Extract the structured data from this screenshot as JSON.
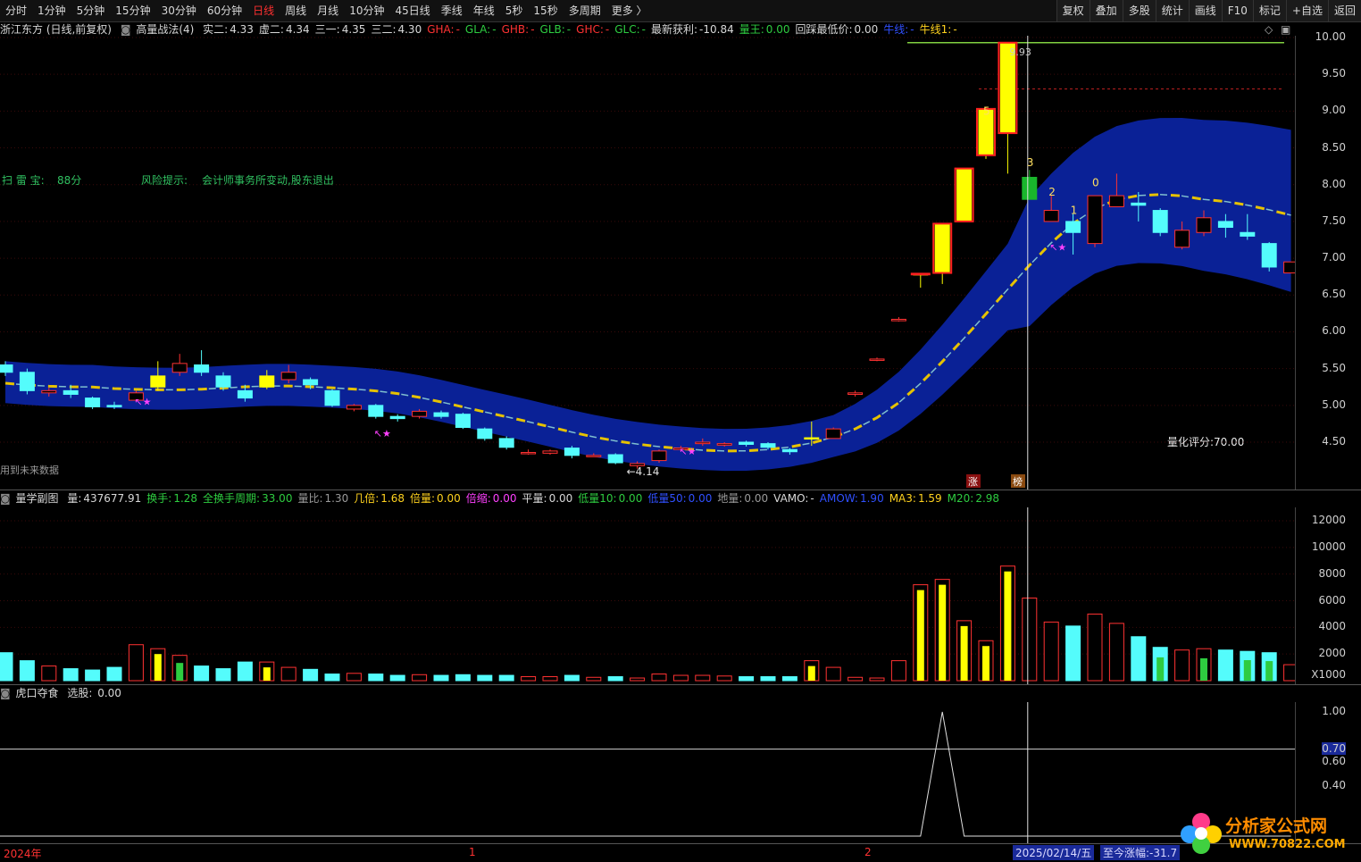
{
  "toolbar": {
    "periods": [
      "分时",
      "1分钟",
      "5分钟",
      "15分钟",
      "30分钟",
      "60分钟",
      "日线",
      "周线",
      "月线",
      "10分钟",
      "45日线",
      "季线",
      "年线",
      "5秒",
      "15秒",
      "多周期",
      "更多 〉"
    ],
    "active_period": "日线",
    "right_buttons": [
      "复权",
      "叠加",
      "多股",
      "统计",
      "画线",
      "F10",
      "标记",
      "+自选",
      "返回"
    ]
  },
  "main_info": {
    "stock": "浙江东方 (日线,前复权)",
    "indicator": "高量战法(4)",
    "items": [
      {
        "label": "实二:",
        "value": "4.33",
        "color": "w"
      },
      {
        "label": "虚二:",
        "value": "4.34",
        "color": "w"
      },
      {
        "label": "三一:",
        "value": "4.35",
        "color": "w"
      },
      {
        "label": "三二:",
        "value": "4.30",
        "color": "w"
      },
      {
        "label": "GHA:",
        "value": "-",
        "color": "r"
      },
      {
        "label": "GLA:",
        "value": "-",
        "color": "g"
      },
      {
        "label": "GHB:",
        "value": "-",
        "color": "r"
      },
      {
        "label": "GLB:",
        "value": "-",
        "color": "g"
      },
      {
        "label": "GHC:",
        "value": "-",
        "color": "r"
      },
      {
        "label": "GLC:",
        "value": "-",
        "color": "g"
      },
      {
        "label": "最新获利:",
        "value": "-10.84",
        "color": "w"
      },
      {
        "label": "量王:",
        "value": "0.00",
        "color": "g"
      },
      {
        "label": "回踩最低价:",
        "value": "0.00",
        "color": "w"
      },
      {
        "label": "牛线:",
        "value": "-",
        "color": "b"
      },
      {
        "label": "牛线1:",
        "value": "-",
        "color": "y"
      }
    ],
    "scan_label": "扫 雷 宝:",
    "scan_value": "88分",
    "risk_label": "风险提示:",
    "risk_value": "会计师事务所变动,股东退出",
    "future_note": "用到未来数据",
    "score_label": "量化评分:70.00",
    "low_label": "←4.14",
    "high_label": "9.93",
    "markers": {
      "zhang": "涨",
      "bang": "榜"
    },
    "candle_numbers": [
      "5",
      "3",
      "2",
      "1",
      "0"
    ]
  },
  "price_axis": [
    "10.00",
    "9.50",
    "9.00",
    "8.50",
    "8.00",
    "7.50",
    "7.00",
    "6.50",
    "6.00",
    "5.50",
    "5.00",
    "4.50"
  ],
  "volume_info": {
    "title": "量学副图",
    "items": [
      {
        "label": "量:",
        "value": "437677.91",
        "color": "w"
      },
      {
        "label": "换手:",
        "value": "1.28",
        "color": "g"
      },
      {
        "label": "全换手周期:",
        "value": "33.00",
        "color": "g"
      },
      {
        "label": "量比:",
        "value": "1.30",
        "color": "gr"
      },
      {
        "label": "几倍:",
        "value": "1.68",
        "color": "y"
      },
      {
        "label": "倍量:",
        "value": "0.00",
        "color": "y"
      },
      {
        "label": "倍缩:",
        "value": "0.00",
        "color": "m"
      },
      {
        "label": "平量:",
        "value": "0.00",
        "color": "w"
      },
      {
        "label": "低量10:",
        "value": "0.00",
        "color": "g"
      },
      {
        "label": "低量50:",
        "value": "0.00",
        "color": "b"
      },
      {
        "label": "地量:",
        "value": "0.00",
        "color": "gr"
      },
      {
        "label": "VAMO:",
        "value": "-",
        "color": "w"
      },
      {
        "label": "AMOW:",
        "value": "1.90",
        "color": "b"
      },
      {
        "label": "MA3:",
        "value": "1.59",
        "color": "y"
      },
      {
        "label": "M20:",
        "value": "2.98",
        "color": "g"
      }
    ]
  },
  "volume_axis": [
    "12000",
    "10000",
    "8000",
    "6000",
    "4000",
    "2000",
    "X1000"
  ],
  "bottom_info": {
    "title": "虎口夺食",
    "label": "选股:",
    "value": "0.00"
  },
  "bottom_axis": [
    "1.00",
    "0.70",
    "0.60",
    "0.40"
  ],
  "date_axis": {
    "year": "2024年",
    "m1": "1",
    "m2": "2",
    "cursor_date": "2025/02/14/五",
    "change": "至今涨幅:-31.7"
  },
  "watermark": {
    "title": "分析家公式网",
    "url": "WWW.70822.COM"
  },
  "colors": {
    "up": "#ff3232",
    "down": "#54fcfc",
    "limit": "#ffff00",
    "band": "#0a2196",
    "ma": "#e6c200"
  },
  "candles": [
    {
      "o": 5.55,
      "c": 5.45,
      "h": 5.6,
      "l": 5.4
    },
    {
      "o": 5.45,
      "c": 5.2,
      "h": 5.5,
      "l": 5.15
    },
    {
      "o": 5.17,
      "c": 5.2,
      "h": 5.24,
      "l": 5.12
    },
    {
      "o": 5.2,
      "c": 5.15,
      "h": 5.28,
      "l": 5.1
    },
    {
      "o": 5.1,
      "c": 4.98,
      "h": 5.12,
      "l": 4.95
    },
    {
      "o": 5.0,
      "c": 4.98,
      "h": 5.05,
      "l": 4.95
    },
    {
      "o": 5.07,
      "c": 5.17,
      "h": 5.2,
      "l": 5.05
    },
    {
      "o": 5.25,
      "c": 5.4,
      "h": 5.6,
      "l": 5.2,
      "yl": 1
    },
    {
      "o": 5.45,
      "c": 5.57,
      "h": 5.7,
      "l": 5.4
    },
    {
      "o": 5.55,
      "c": 5.45,
      "h": 5.75,
      "l": 5.4
    },
    {
      "o": 5.4,
      "c": 5.25,
      "h": 5.45,
      "l": 5.2
    },
    {
      "o": 5.2,
      "c": 5.1,
      "h": 5.28,
      "l": 5.05
    },
    {
      "o": 5.25,
      "c": 5.4,
      "h": 5.48,
      "l": 5.22,
      "yl": 1
    },
    {
      "o": 5.35,
      "c": 5.45,
      "h": 5.55,
      "l": 5.3
    },
    {
      "o": 5.35,
      "c": 5.28,
      "h": 5.38,
      "l": 5.22
    },
    {
      "o": 5.2,
      "c": 5.0,
      "h": 5.22,
      "l": 4.98
    },
    {
      "o": 4.95,
      "c": 5.0,
      "h": 5.02,
      "l": 4.92
    },
    {
      "o": 5.0,
      "c": 4.85,
      "h": 5.02,
      "l": 4.82
    },
    {
      "o": 4.85,
      "c": 4.82,
      "h": 4.88,
      "l": 4.78
    },
    {
      "o": 4.85,
      "c": 4.92,
      "h": 4.95,
      "l": 4.82
    },
    {
      "o": 4.9,
      "c": 4.85,
      "h": 4.93,
      "l": 4.82
    },
    {
      "o": 4.88,
      "c": 4.7,
      "h": 4.9,
      "l": 4.68
    },
    {
      "o": 4.68,
      "c": 4.55,
      "h": 4.7,
      "l": 4.52
    },
    {
      "o": 4.55,
      "c": 4.43,
      "h": 4.58,
      "l": 4.4
    },
    {
      "o": 4.36,
      "c": 4.36,
      "h": 4.4,
      "l": 4.33
    },
    {
      "o": 4.35,
      "c": 4.38,
      "h": 4.4,
      "l": 4.33
    },
    {
      "o": 4.42,
      "c": 4.32,
      "h": 4.45,
      "l": 4.28
    },
    {
      "o": 4.32,
      "c": 4.32,
      "h": 4.35,
      "l": 4.3
    },
    {
      "o": 4.33,
      "c": 4.22,
      "h": 4.35,
      "l": 4.2
    },
    {
      "o": 4.18,
      "c": 4.21,
      "h": 4.24,
      "l": 4.14
    },
    {
      "o": 4.25,
      "c": 4.38,
      "h": 4.4,
      "l": 4.22
    },
    {
      "o": 4.4,
      "c": 4.42,
      "h": 4.45,
      "l": 4.38
    },
    {
      "o": 4.48,
      "c": 4.5,
      "h": 4.55,
      "l": 4.45
    },
    {
      "o": 4.46,
      "c": 4.48,
      "h": 4.5,
      "l": 4.44
    },
    {
      "o": 4.5,
      "c": 4.47,
      "h": 4.52,
      "l": 4.44
    },
    {
      "o": 4.48,
      "c": 4.43,
      "h": 4.5,
      "l": 4.4
    },
    {
      "o": 4.4,
      "c": 4.37,
      "h": 4.42,
      "l": 4.33
    },
    {
      "o": 4.55,
      "c": 4.56,
      "h": 4.78,
      "l": 4.45,
      "yl": 1
    },
    {
      "o": 4.55,
      "c": 4.68,
      "h": 4.7,
      "l": 4.55
    },
    {
      "o": 5.15,
      "c": 5.17,
      "h": 5.2,
      "l": 5.12
    },
    {
      "o": 5.62,
      "c": 5.63,
      "h": 5.65,
      "l": 5.6
    },
    {
      "o": 6.15,
      "c": 6.17,
      "h": 6.2,
      "l": 6.14
    },
    {
      "o": 6.78,
      "c": 6.79,
      "h": 6.79,
      "l": 6.6,
      "yl": 1
    },
    {
      "o": 6.8,
      "c": 7.47,
      "h": 7.48,
      "l": 6.65,
      "yl": 1
    },
    {
      "o": 7.5,
      "c": 8.22,
      "h": 8.22,
      "l": 7.5,
      "yl": 1
    },
    {
      "o": 8.4,
      "c": 9.03,
      "h": 9.05,
      "l": 8.35,
      "yl": 1
    },
    {
      "o": 8.7,
      "c": 9.93,
      "h": 9.93,
      "l": 8.15,
      "yl": 1
    },
    {
      "o": 7.8,
      "c": 8.1,
      "h": 8.2,
      "l": 7.8,
      "gb": 1
    },
    {
      "o": 7.5,
      "c": 7.65,
      "h": 7.85,
      "l": 7.5
    },
    {
      "o": 7.5,
      "c": 7.35,
      "h": 7.6,
      "l": 7.05
    },
    {
      "o": 7.2,
      "c": 7.85,
      "h": 7.85,
      "l": 7.15
    },
    {
      "o": 7.7,
      "c": 7.85,
      "h": 8.15,
      "l": 7.7
    },
    {
      "o": 7.75,
      "c": 7.72,
      "h": 7.9,
      "l": 7.5
    },
    {
      "o": 7.65,
      "c": 7.35,
      "h": 7.68,
      "l": 7.3
    },
    {
      "o": 7.15,
      "c": 7.38,
      "h": 7.5,
      "l": 7.12
    },
    {
      "o": 7.35,
      "c": 7.55,
      "h": 7.65,
      "l": 7.3
    },
    {
      "o": 7.5,
      "c": 7.42,
      "h": 7.6,
      "l": 7.28
    },
    {
      "o": 7.35,
      "c": 7.3,
      "h": 7.6,
      "l": 7.25
    },
    {
      "o": 7.2,
      "c": 6.88,
      "h": 7.22,
      "l": 6.82
    },
    {
      "o": 6.8,
      "c": 6.95,
      "h": 6.95,
      "l": 6.8
    }
  ],
  "volumes": [
    2100,
    1500,
    1100,
    900,
    800,
    1000,
    2700,
    2400,
    1900,
    1100,
    900,
    1400,
    1400,
    1000,
    850,
    500,
    550,
    500,
    400,
    450,
    400,
    450,
    400,
    400,
    300,
    300,
    400,
    250,
    300,
    200,
    500,
    400,
    400,
    350,
    300,
    300,
    300,
    1500,
    1000,
    250,
    200,
    1500,
    7200,
    7600,
    4500,
    3000,
    8600,
    6200,
    4400,
    4100,
    5000,
    4300,
    3300,
    2500,
    2300,
    2400,
    2300,
    2200,
    2100,
    1200
  ],
  "bottom_series": [
    0,
    0,
    0,
    0,
    0,
    0,
    0,
    0,
    0,
    0,
    0,
    0,
    0,
    0,
    0,
    0,
    0,
    0,
    0,
    0,
    0,
    0,
    0,
    0,
    0,
    0,
    0,
    0,
    0,
    0,
    0,
    0,
    0,
    0,
    0,
    0,
    0,
    0,
    0,
    0,
    0,
    0,
    0,
    1,
    0,
    0,
    0,
    0,
    0,
    0,
    0,
    0,
    0,
    0,
    0,
    0,
    0,
    0,
    0,
    0
  ]
}
